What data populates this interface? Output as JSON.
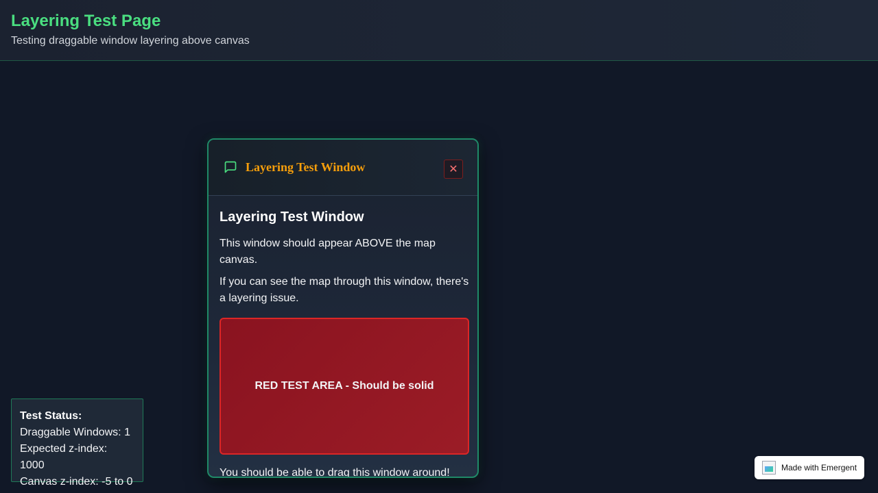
{
  "header": {
    "title": "Layering Test Page",
    "subtitle": "Testing draggable window layering above canvas"
  },
  "window": {
    "title": "Layering Test Window",
    "icon": "message-square-icon",
    "close_label": "✕",
    "heading": "Layering Test Window",
    "paragraphs": [
      "This window should appear ABOVE the map canvas.",
      "If you can see the map through this window, there's a layering issue."
    ],
    "red_area_label": "RED TEST AREA - Should be solid",
    "drag_text": "You should be able to drag this window around!"
  },
  "status": {
    "title": "Test Status:",
    "lines": [
      "Draggable Windows: 1",
      "Expected z-index: 1000",
      "Canvas z-index: -5 to 0"
    ]
  },
  "badge": {
    "label": "Made with Emergent"
  },
  "colors": {
    "accent_green": "#4ade80",
    "window_title_orange": "#f59e0b",
    "red_area": "#991b1b",
    "background": "#111827"
  }
}
